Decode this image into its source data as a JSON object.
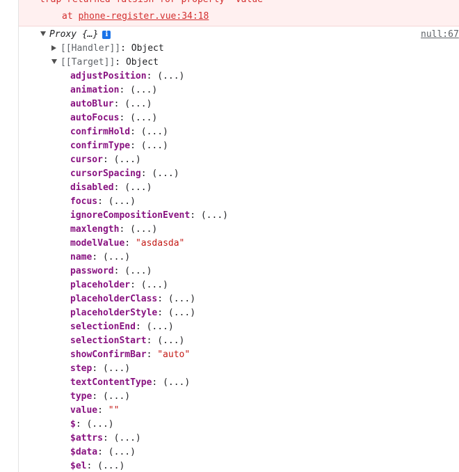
{
  "error": {
    "line1": "trap returned falsish for property 'value'",
    "at_keyword": "at",
    "location": "phone-register.vue:34:18"
  },
  "proxy": {
    "label": "Proxy {…}",
    "info_icon": "i",
    "source_link": "null:67"
  },
  "internal": {
    "handler": {
      "key": "[[Handler]]",
      "sep": ": ",
      "value": "Object"
    },
    "target": {
      "key": "[[Target]]",
      "sep": ": ",
      "value": "Object"
    }
  },
  "properties": [
    {
      "key": "adjustPosition",
      "value": "(...)"
    },
    {
      "key": "animation",
      "value": "(...)"
    },
    {
      "key": "autoBlur",
      "value": "(...)"
    },
    {
      "key": "autoFocus",
      "value": "(...)"
    },
    {
      "key": "confirmHold",
      "value": "(...)"
    },
    {
      "key": "confirmType",
      "value": "(...)"
    },
    {
      "key": "cursor",
      "value": "(...)"
    },
    {
      "key": "cursorSpacing",
      "value": "(...)"
    },
    {
      "key": "disabled",
      "value": "(...)"
    },
    {
      "key": "focus",
      "value": "(...)"
    },
    {
      "key": "ignoreCompositionEvent",
      "value": "(...)"
    },
    {
      "key": "maxlength",
      "value": "(...)"
    },
    {
      "key": "modelValue",
      "value": "\"asdasda\""
    },
    {
      "key": "name",
      "value": "(...)"
    },
    {
      "key": "password",
      "value": "(...)"
    },
    {
      "key": "placeholder",
      "value": "(...)"
    },
    {
      "key": "placeholderClass",
      "value": "(...)"
    },
    {
      "key": "placeholderStyle",
      "value": "(...)"
    },
    {
      "key": "selectionEnd",
      "value": "(...)"
    },
    {
      "key": "selectionStart",
      "value": "(...)"
    },
    {
      "key": "showConfirmBar",
      "value": "\"auto\""
    },
    {
      "key": "step",
      "value": "(...)"
    },
    {
      "key": "textContentType",
      "value": "(...)"
    },
    {
      "key": "type",
      "value": "(...)"
    },
    {
      "key": "value",
      "value": "\"\""
    },
    {
      "key": "$",
      "value": "(...)"
    },
    {
      "key": "$attrs",
      "value": "(...)"
    },
    {
      "key": "$data",
      "value": "(...)"
    },
    {
      "key": "$el",
      "value": "(...)"
    }
  ],
  "colors": {
    "property_key": "#881280",
    "string_value": "#c41a16",
    "error_text": "#d32f2f",
    "error_bg": "#fff0f0",
    "info_icon_bg": "#1a73e8"
  }
}
